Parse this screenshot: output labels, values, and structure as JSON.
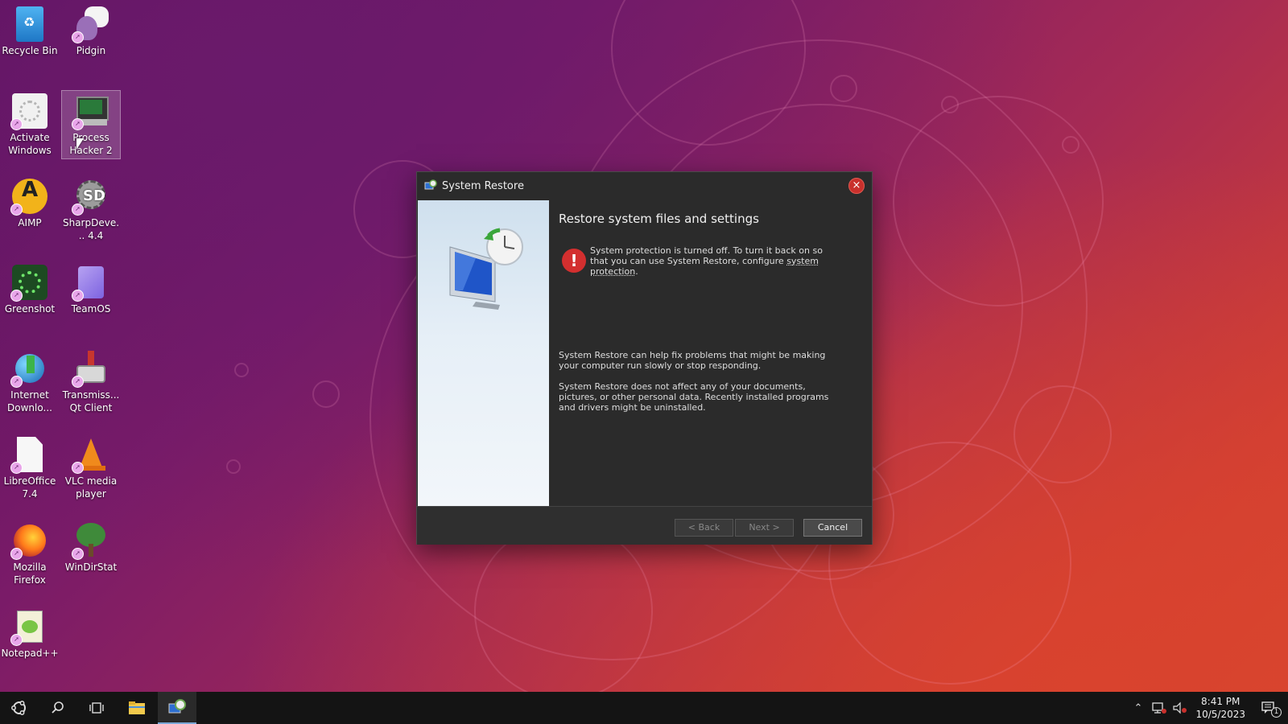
{
  "desktop": {
    "icons": [
      {
        "label": "Recycle Bin",
        "icon": "recycle-bin-icon"
      },
      {
        "label": "Pidgin",
        "icon": "pidgin-icon"
      },
      {
        "label": "Activate Windows",
        "icon": "activate-windows-icon"
      },
      {
        "label": "Process Hacker 2",
        "icon": "process-hacker-icon"
      },
      {
        "label": "AIMP",
        "icon": "aimp-icon"
      },
      {
        "label": "SharpDeve... 4.4",
        "icon": "sharpdevelop-icon"
      },
      {
        "label": "Greenshot",
        "icon": "greenshot-icon"
      },
      {
        "label": "TeamOS",
        "icon": "teamos-icon"
      },
      {
        "label": "Internet Downlo...",
        "icon": "internet-download-manager-icon"
      },
      {
        "label": "Transmiss... Qt Client",
        "icon": "transmission-icon"
      },
      {
        "label": "LibreOffice 7.4",
        "icon": "libreoffice-icon"
      },
      {
        "label": "VLC media player",
        "icon": "vlc-icon"
      },
      {
        "label": "Mozilla Firefox",
        "icon": "firefox-icon"
      },
      {
        "label": "WinDirStat",
        "icon": "windirstat-icon"
      },
      {
        "label": "Notepad++",
        "icon": "notepadpp-icon"
      }
    ]
  },
  "dialog": {
    "title": "System Restore",
    "heading": "Restore system files and settings",
    "warning_prefix": "System protection is turned off. To turn it back on so that you can use System Restore, configure ",
    "warning_link": "system protection",
    "warning_suffix": ".",
    "para1": "System Restore can help fix problems that might be making your computer run slowly or stop responding.",
    "para2": "System Restore does not affect any of your documents, pictures, or other personal data. Recently installed programs and drivers might be uninstalled.",
    "buttons": {
      "back": "< Back",
      "next": "Next >",
      "cancel": "Cancel"
    }
  },
  "taskbar": {
    "items": [
      "start-icon",
      "search-icon",
      "task-view-icon",
      "file-explorer-icon",
      "system-restore-icon"
    ],
    "clock": {
      "time": "8:41 PM",
      "date": "10/5/2023"
    },
    "notification_count": "1"
  },
  "colors": {
    "accent": "#7aa7d6",
    "close": "#c9302c",
    "warning": "#d32f2f"
  }
}
